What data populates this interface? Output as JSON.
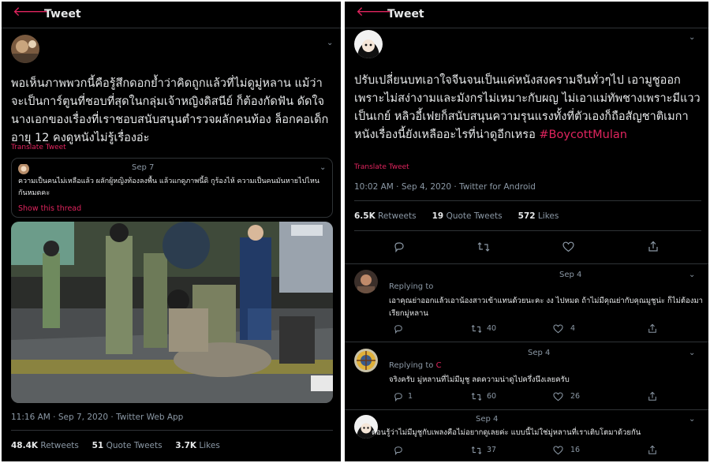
{
  "left": {
    "header_title": "Tweet",
    "tweet_text": "พอเห็นภาพพวกนี้คือรู้สึกดอกย้ำว่าคิดถูกแล้วที่ไม่ดูมู่หลาน แม้ว่าจะเป็นการ์ตูนที่ชอบที่สุดในกลุ่มเจ้าหญิงดิสนีย์ ก็ต้องกัดฟัน ดัดใจ นางเอกของเรื่องที่เราชอบสนับสนุนตำรวจผลักคนท้อง ล็อกคอเด็กอายุ 12 คงดูหนังไม่รู้เรื่องอ่ะ",
    "translate": "Translate Tweet",
    "quote": {
      "date": "Sep 7",
      "text": "ความเป็นคนไม่เหลือแล้ว ผลักผู้หญิงท้องลงพื้น แล้วแกดูภาพนี้ดิ กูร้องไห้ ความเป็นคนมันหายไปไหนกันหมดคะ",
      "show_thread": "Show this thread"
    },
    "timestamp": "11:16 AM · Sep 7, 2020 · Twitter Web App",
    "stats": {
      "retweets_num": "48.4K",
      "retweets_label": "Retweets",
      "quotes_num": "51",
      "quotes_label": "Quote Tweets",
      "likes_num": "3.7K",
      "likes_label": "Likes"
    }
  },
  "right": {
    "header_title": "Tweet",
    "tweet_text": "ปรับเปลี่ยนบทเอาใจจีนจนเป็นแค่หนังสงครามจีนทั่วๆไป เอามูชูออกเพราะไม่สง่างามและมังกรไม่เหมาะกับผญ ไม่เอาแม่ทัพชางเพราะมีแววเป็นเกย์ หลิวอี้เฟยก็สนับสนุนความรุนแรงทั้งที่ตัวเองก็ถือสัญชาติเมกา หนังเรื่องนี้ยังเหลืออะไรที่น่าดูอีกเหรอ",
    "hashtag": "#BoycottMulan",
    "translate": "Translate Tweet",
    "timestamp": "10:02 AM · Sep 4, 2020 · Twitter for Android",
    "stats": {
      "retweets_num": "6.5K",
      "retweets_label": "Retweets",
      "quotes_num": "19",
      "quotes_label": "Quote Tweets",
      "likes_num": "572",
      "likes_label": "Likes"
    },
    "replies": [
      {
        "date": "Sep 4",
        "replying": "Replying to",
        "text": "เอาคุณย่าออกแล้วเอาน้องสาวเข้าแทนด้วยนะคะ งง ไปหมด ถ้าไม่มีคุณย่ากับคุณมูชูน่ะ ก็ไม่ต้องมาเรียกมู่หลาน",
        "retweets": "40",
        "likes": "4"
      },
      {
        "date": "Sep 4",
        "replying": "Replying to",
        "replying_handle": "C",
        "text": "จริงครับ มู่หลานที่ไม่มีมูชู ลดความน่าดูไปครึ่งนึงเลยครับ",
        "replies": "1",
        "retweets": "60",
        "likes": "26"
      },
      {
        "date": "Sep 4",
        "text": "ตอนรู้ว่าไม่มีมูชูกับเพลงคือไม่อยากดูเลยค่ะ แบบนี้ไม่ใช่มู่หลานที่เราเติบโตมาด้วยกัน",
        "retweets": "37",
        "likes": "16"
      }
    ]
  },
  "colors": {
    "accent": "#e0245e",
    "background": "#000000",
    "muted": "#8b98a5",
    "text": "#e7e9ea",
    "divider": "#2f3336"
  }
}
